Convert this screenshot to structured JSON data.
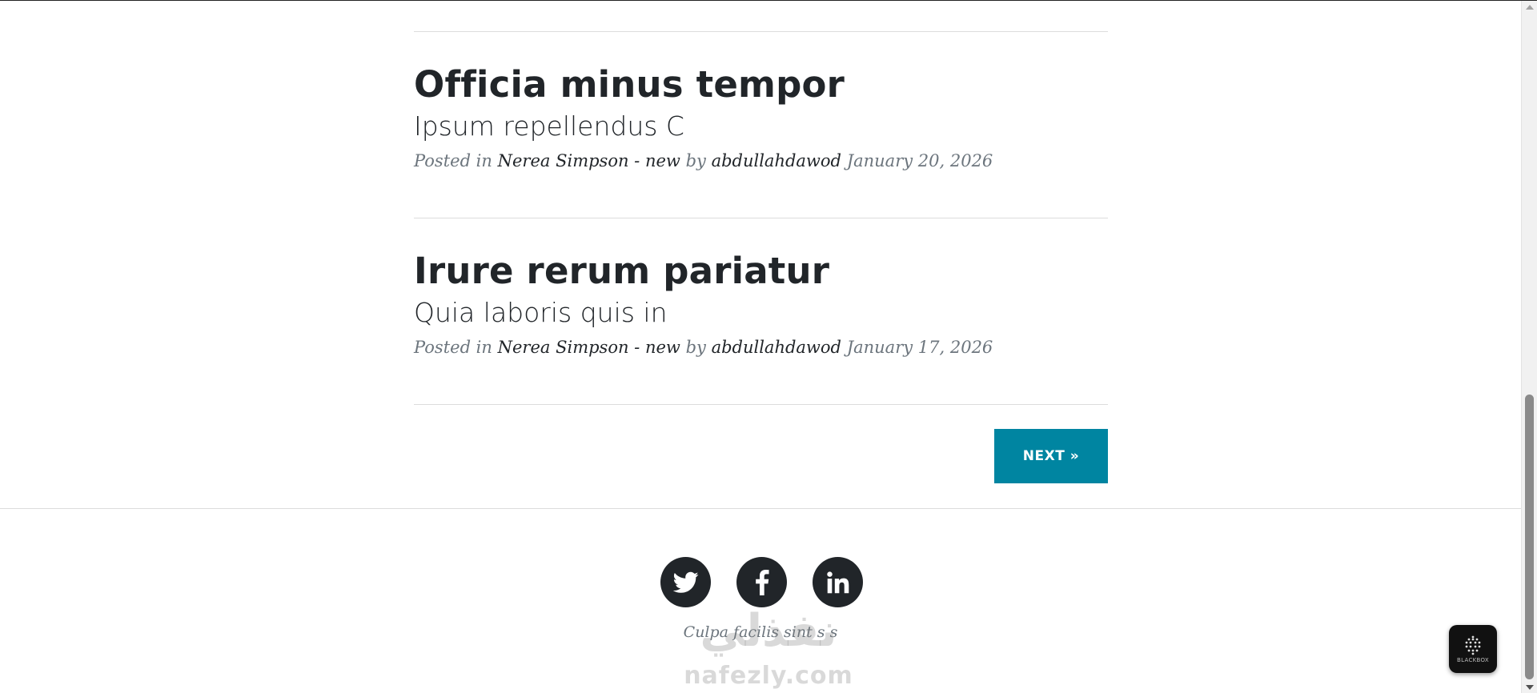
{
  "posts": [
    {
      "title": "Officia minus tempor",
      "subtitle": "Ipsum repellendus C",
      "meta_posted_in": "Posted in",
      "category": "Nerea Simpson - new",
      "meta_by": "by",
      "author": "abdullahdawod",
      "date": "January 20, 2026"
    },
    {
      "title": "Irure rerum pariatur",
      "subtitle": "Quia laboris quis in",
      "meta_posted_in": "Posted in",
      "category": "Nerea Simpson - new",
      "meta_by": "by",
      "author": "abdullahdawod",
      "date": "January 17, 2026"
    }
  ],
  "pagination": {
    "next_label": "NEXT »"
  },
  "footer": {
    "social": [
      "twitter-icon",
      "facebook-icon",
      "linkedin-icon"
    ],
    "copyright": "Culpa facilis sint s s"
  },
  "watermark": {
    "arabic": "نفذلي",
    "latin": "nafezly.com"
  },
  "widget": {
    "label": "BLACKBOX"
  },
  "colors": {
    "accent": "#0085a1",
    "text": "#212529",
    "muted": "#6c757d"
  }
}
